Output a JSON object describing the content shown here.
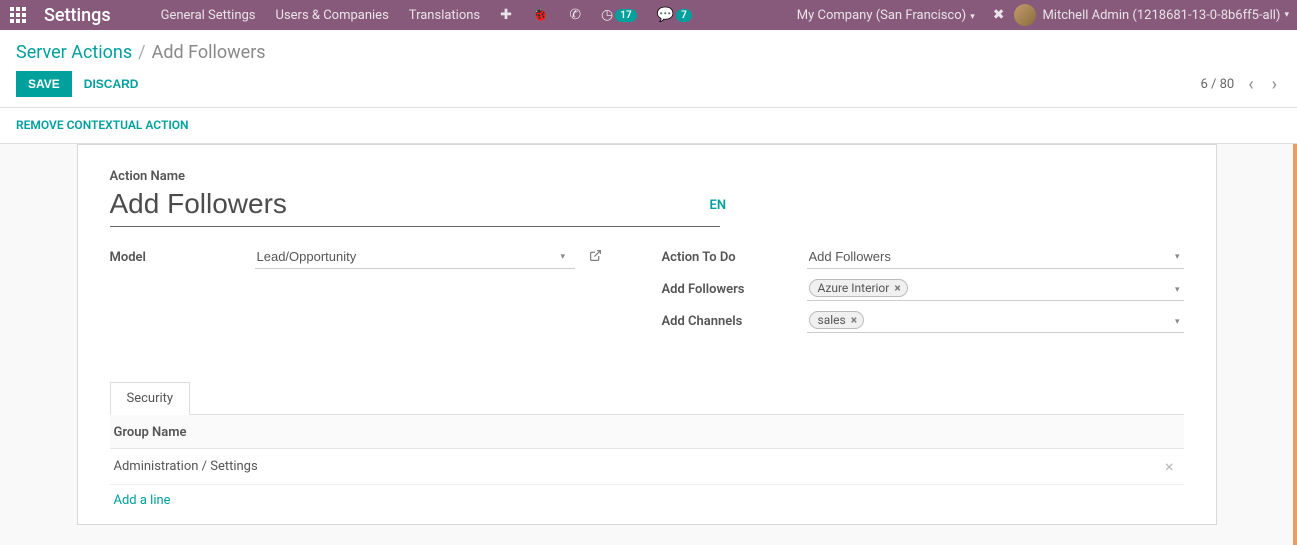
{
  "navbar": {
    "brand": "Settings",
    "links": [
      "General Settings",
      "Users & Companies",
      "Translations"
    ],
    "clock_badge": "17",
    "chat_badge": "7",
    "company": "My Company (San Francisco)",
    "user": "Mitchell Admin (1218681-13-0-8b6ff5-all)"
  },
  "breadcrumb": {
    "parent": "Server Actions",
    "current": "Add Followers"
  },
  "buttons": {
    "save": "Save",
    "discard": "Discard"
  },
  "pager": {
    "position": "6 / 80"
  },
  "action_bar": {
    "remove_contextual": "Remove Contextual Action"
  },
  "form": {
    "action_name_label": "Action Name",
    "action_name_value": "Add Followers",
    "lang": "EN",
    "model_label": "Model",
    "model_value": "Lead/Opportunity",
    "action_to_do_label": "Action To Do",
    "action_to_do_value": "Add Followers",
    "add_followers_label": "Add Followers",
    "add_followers_tags": [
      "Azure Interior"
    ],
    "add_channels_label": "Add Channels",
    "add_channels_tags": [
      "sales"
    ]
  },
  "tabs": {
    "security": "Security"
  },
  "security_table": {
    "header": "Group Name",
    "rows": [
      "Administration / Settings"
    ],
    "add_line": "Add a line"
  }
}
